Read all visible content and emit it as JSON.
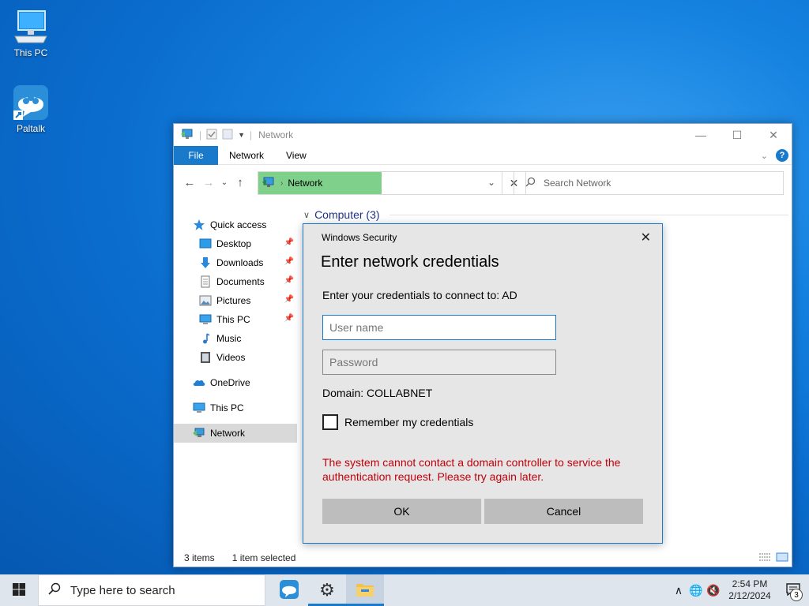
{
  "desktop": {
    "icons": [
      {
        "label": "This PC",
        "icon": "computer-icon"
      },
      {
        "label": "Paltalk",
        "icon": "paltalk-icon"
      }
    ]
  },
  "explorer": {
    "title": "Network",
    "ribbon": {
      "file": "File",
      "tabs": [
        "Network",
        "View"
      ]
    },
    "address": {
      "segment": "Network"
    },
    "search": {
      "placeholder": "Search Network"
    },
    "sidebar": {
      "items": [
        {
          "label": "Quick access",
          "icon": "star-icon"
        },
        {
          "label": "Desktop",
          "icon": "desktop-folder-icon",
          "pinned": true
        },
        {
          "label": "Downloads",
          "icon": "download-arrow-icon",
          "pinned": true
        },
        {
          "label": "Documents",
          "icon": "document-icon",
          "pinned": true
        },
        {
          "label": "Pictures",
          "icon": "pictures-icon",
          "pinned": true
        },
        {
          "label": "This PC",
          "icon": "computer-icon",
          "pinned": true
        },
        {
          "label": "Music",
          "icon": "music-note-icon"
        },
        {
          "label": "Videos",
          "icon": "video-icon"
        },
        {
          "label": "OneDrive",
          "icon": "cloud-icon"
        },
        {
          "label": "This PC",
          "icon": "computer-icon"
        },
        {
          "label": "Network",
          "icon": "network-icon",
          "selected": true
        }
      ]
    },
    "content": {
      "group": "Computer (3)"
    },
    "status": {
      "items": "3 items",
      "selected": "1 item selected"
    }
  },
  "dialog": {
    "window_title": "Windows Security",
    "heading": "Enter network credentials",
    "prompt": "Enter your credentials to connect to: AD",
    "username_placeholder": "User name",
    "password_placeholder": "Password",
    "domain": "Domain: COLLABNET",
    "remember": "Remember my credentials",
    "error": "The system cannot contact a domain controller to service the authentication request. Please try again later.",
    "ok": "OK",
    "cancel": "Cancel"
  },
  "taskbar": {
    "search_placeholder": "Type here to search",
    "time": "2:54 PM",
    "date": "2/12/2024",
    "notifications": "3"
  },
  "colors": {
    "accent": "#1979ca",
    "address_highlight": "#7fd08a",
    "error": "#c0000b"
  }
}
